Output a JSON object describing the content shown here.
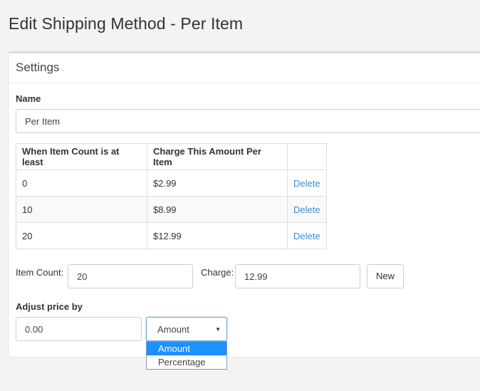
{
  "page": {
    "title": "Edit Shipping Method - Per Item"
  },
  "panel": {
    "heading": "Settings"
  },
  "name_field": {
    "label": "Name",
    "value": "Per Item"
  },
  "rates_table": {
    "columns": [
      "When Item Count is at least",
      "Charge This Amount Per Item",
      ""
    ],
    "rows": [
      {
        "count": "0",
        "charge": "$2.99",
        "action": "Delete"
      },
      {
        "count": "10",
        "charge": "$8.99",
        "action": "Delete"
      },
      {
        "count": "20",
        "charge": "$12.99",
        "action": "Delete"
      }
    ]
  },
  "new_rate": {
    "item_count_label": "Item Count:",
    "item_count_value": "20",
    "charge_label": "Charge:",
    "charge_value": "12.99",
    "new_button": "New"
  },
  "adjust_price": {
    "label": "Adjust price by",
    "value": "0.00",
    "mode_selected": "Amount",
    "mode_options": [
      "Amount",
      "Percentage"
    ]
  },
  "colors": {
    "link": "#3a8ed0",
    "selected_option": "#1e90ff"
  }
}
